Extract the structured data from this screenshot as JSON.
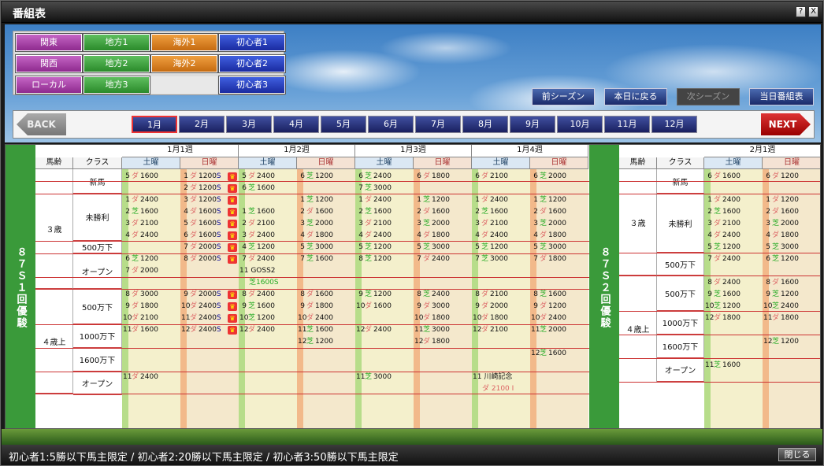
{
  "window": {
    "title": "番組表",
    "help": "?",
    "close": "X"
  },
  "categories": [
    [
      {
        "label": "関東",
        "color": "pink"
      },
      {
        "label": "地方1",
        "color": "green"
      },
      {
        "label": "海外1",
        "color": "orange"
      },
      {
        "label": "初心者1",
        "color": "blue"
      }
    ],
    [
      {
        "label": "関西",
        "color": "pink"
      },
      {
        "label": "地方2",
        "color": "green"
      },
      {
        "label": "海外2",
        "color": "orange"
      },
      {
        "label": "初心者2",
        "color": "blue"
      }
    ],
    [
      {
        "label": "ローカル",
        "color": "pink"
      },
      {
        "label": "地方3",
        "color": "green"
      },
      {
        "label": "",
        "color": "empty"
      },
      {
        "label": "初心者3",
        "color": "blue"
      }
    ]
  ],
  "season_buttons": {
    "prev": "前シーズン",
    "today": "本日に戻る",
    "next": "次シーズン",
    "today_program": "当日番組表"
  },
  "nav": {
    "back": "BACK",
    "next": "NEXT",
    "selected_month": "1月"
  },
  "months": [
    "1月",
    "2月",
    "3月",
    "4月",
    "5月",
    "6月",
    "7月",
    "8月",
    "9月",
    "10月",
    "11月",
    "12月"
  ],
  "meetings": [
    "８７Ｓ１回優駿",
    "８７Ｓ２回優駿"
  ],
  "weeks": [
    "1月1週",
    "1月2週",
    "1月3週",
    "1月4週",
    "2月1週"
  ],
  "days": {
    "sat": "土曜",
    "sun": "日曜"
  },
  "headers": {
    "age": "馬齢",
    "class": "クラス"
  },
  "ages": [
    "３歳",
    "４歳上"
  ],
  "classes": [
    "新馬",
    "未勝利",
    "500万下",
    "オープン",
    "500万下",
    "1000万下",
    "1600万下",
    "オープン"
  ],
  "classes2": [
    "新馬",
    "未勝利",
    "500万下",
    "500万下",
    "1000万下",
    "1600万下",
    "オープン"
  ],
  "races": [
    "5|ダ|1600||0|0",
    "6|ダ|2400||1|0",
    "7|芝|3000||1|1",
    "1|ダ|2400||2|0",
    "2|芝|1600||2|1",
    "3|ダ|2100||2|2",
    "4|ダ|2400||2|3",
    "1|ダ|2400||3|0",
    "2|ダ|1600||3|1",
    "3|ダ|2100||3|2",
    "4|ダ|2400||3|3",
    "5|芝|1200||3|4",
    "6|芝|1200||4|0",
    "7|ダ|2000||5|0",
    "8|ダ|3000||6|0",
    "9|ダ|1800||6|1",
    "10|ダ|2100||6|2",
    "11|ダ|1600||6|3",
    "11|ダ|2400||7|0"
  ],
  "footer": {
    "note": "初心者1:5勝以下馬主限定 / 初心者2:20勝以下馬主限定 / 初心者3:50勝以下馬主限定",
    "close": "閉じる"
  }
}
